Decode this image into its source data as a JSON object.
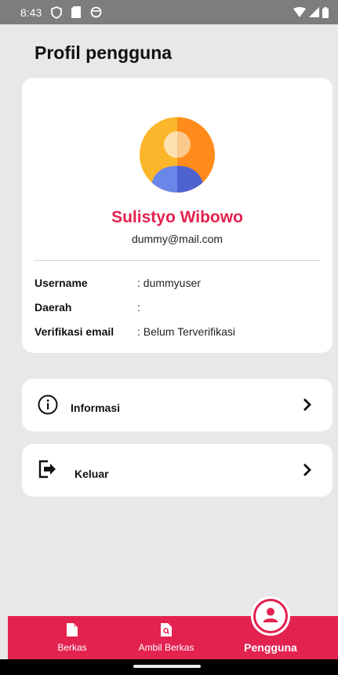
{
  "status_bar": {
    "time": "8:43"
  },
  "page": {
    "title": "Profil pengguna"
  },
  "profile": {
    "name": "Sulistyo Wibowo",
    "email": "dummy@mail.com",
    "fields": [
      {
        "label": "Username",
        "value": ": dummyuser"
      },
      {
        "label": "Daerah",
        "value": ":"
      },
      {
        "label": "Verifikasi email",
        "value": ": Belum Terverifikasi"
      }
    ]
  },
  "menu": [
    {
      "label": "Informasi",
      "icon": "info-icon"
    },
    {
      "label": "Keluar",
      "icon": "logout-icon"
    }
  ],
  "bottom_nav": {
    "items": [
      {
        "label": "Berkas",
        "icon": "file-icon"
      },
      {
        "label": "Ambil Berkas",
        "icon": "file-search-icon"
      },
      {
        "label": "Pengguna",
        "icon": "user-icon",
        "active": true
      }
    ]
  },
  "colors": {
    "accent": "#e3224f",
    "background": "#e8e8ea",
    "status_bar": "#7d7d7d"
  }
}
